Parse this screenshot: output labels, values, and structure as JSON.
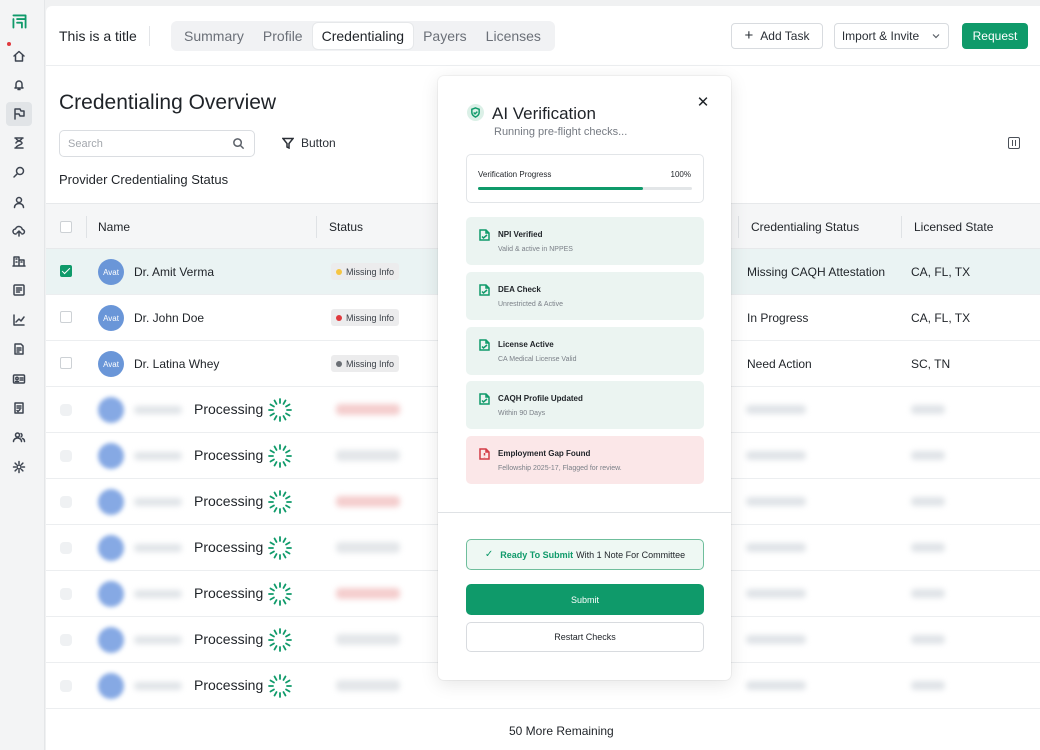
{
  "header": {
    "title": "This is a title",
    "tabs": [
      {
        "label": "Summary"
      },
      {
        "label": "Profile"
      },
      {
        "label": "Credentialing"
      },
      {
        "label": "Payers"
      },
      {
        "label": "Licenses"
      }
    ],
    "active_tab": "Credentialing",
    "add_task_label": "Add Task",
    "import_invite_label": "Import & Invite",
    "request_label": "Request"
  },
  "page": {
    "heading": "Credentialing Overview",
    "search_placeholder": "Search",
    "filter_button_label": "Button",
    "section_heading": "Provider Credentialing Status",
    "remaining_label": "50 More Remaining"
  },
  "table": {
    "columns": [
      "Name",
      "Status",
      "Credentialing Status",
      "Licensed State"
    ],
    "rows": [
      {
        "avatar": "Avat",
        "name": "Dr. Amit Verma",
        "status": "Missing Info",
        "status_color": "#f5c542",
        "credentialing_status": "Missing CAQH Attestation",
        "licensed_state": "CA, FL, TX",
        "checked": true
      },
      {
        "avatar": "Avat",
        "name": "Dr. John Doe",
        "status": "Missing Info",
        "status_color": "#e0393e",
        "credentialing_status": "In Progress",
        "licensed_state": "CA, FL, TX",
        "checked": false
      },
      {
        "avatar": "Avat",
        "name": "Dr. Latina Whey",
        "status": "Missing Info",
        "status_color": "#6b6f75",
        "credentialing_status": "Need Action",
        "licensed_state": "SC, TN",
        "checked": false
      }
    ],
    "processing_label": "Processing"
  },
  "modal": {
    "title": "AI Verification",
    "subtitle": "Running pre-flight checks...",
    "close_icon": "close-icon",
    "progress_label": "Verification Progress",
    "progress_value_text": "100%",
    "progress_fraction": 1.0,
    "checks": [
      {
        "title": "NPI Verified",
        "subtitle": "Valid & active in NPPES",
        "state": "ok"
      },
      {
        "title": "DEA Check",
        "subtitle": "Unrestricted & Active",
        "state": "ok"
      },
      {
        "title": "License Active",
        "subtitle": "CA Medical License Valid",
        "state": "ok"
      },
      {
        "title": "CAQH Profile Updated",
        "subtitle": "Within 90 Days",
        "state": "ok"
      },
      {
        "title": "Employment Gap Found",
        "subtitle": "Fellowship 2025-17, Flagged for review.",
        "state": "warn"
      }
    ],
    "ready_strong": "Ready To Submit",
    "ready_rest": "With 1 Note For Committee",
    "submit_label": "Submit",
    "restart_label": "Restart Checks"
  },
  "colors": {
    "accent": "#0f9a6a",
    "warning_bg": "#fbe7e8",
    "ok_bg": "#ebf4f1"
  },
  "sidebar_icons": [
    "logo-icon",
    "home-icon",
    "bell-icon",
    "flag-icon",
    "hourglass-icon",
    "search-icon",
    "user-icon",
    "cloud-upload-icon",
    "building-icon",
    "list-icon",
    "chart-icon",
    "document-icon",
    "id-card-icon",
    "checklist-icon",
    "users-icon",
    "settings-icon"
  ]
}
